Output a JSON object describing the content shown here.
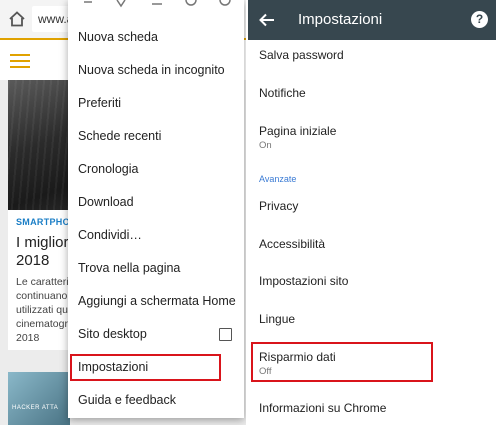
{
  "browser": {
    "url_text": "www.a",
    "colors": {
      "accent": "#e0a200",
      "link": "#1a7ec6",
      "highlight": "#d9141b"
    }
  },
  "article": {
    "category": "SMARTPHON",
    "title": "I miglior 2018",
    "text": "Le caratteri continuano utilizzati que cinematogr 2018",
    "second_label": "HACKER ATTA"
  },
  "menu": {
    "items": [
      {
        "label": "Nuova scheda"
      },
      {
        "label": "Nuova scheda in incognito"
      },
      {
        "label": "Preferiti"
      },
      {
        "label": "Schede recenti"
      },
      {
        "label": "Cronologia"
      },
      {
        "label": "Download"
      },
      {
        "label": "Condividi…"
      },
      {
        "label": "Trova nella pagina"
      },
      {
        "label": "Aggiungi a schermata Home"
      },
      {
        "label": "Sito desktop",
        "checkbox": false
      },
      {
        "label": "Impostazioni",
        "highlighted": true
      },
      {
        "label": "Guida e feedback"
      }
    ]
  },
  "settings": {
    "title": "Impostazioni",
    "appbar_color": "#37474f",
    "section_label": "Avanzate",
    "items": [
      {
        "label": "Salva password"
      },
      {
        "label": "Notifiche"
      },
      {
        "label": "Pagina iniziale",
        "sub": "On"
      },
      {
        "label": "Privacy"
      },
      {
        "label": "Accessibilità"
      },
      {
        "label": "Impostazioni sito"
      },
      {
        "label": "Lingue"
      },
      {
        "label": "Risparmio dati",
        "sub": "Off",
        "highlighted": true
      },
      {
        "label": "Informazioni su Chrome"
      }
    ]
  }
}
